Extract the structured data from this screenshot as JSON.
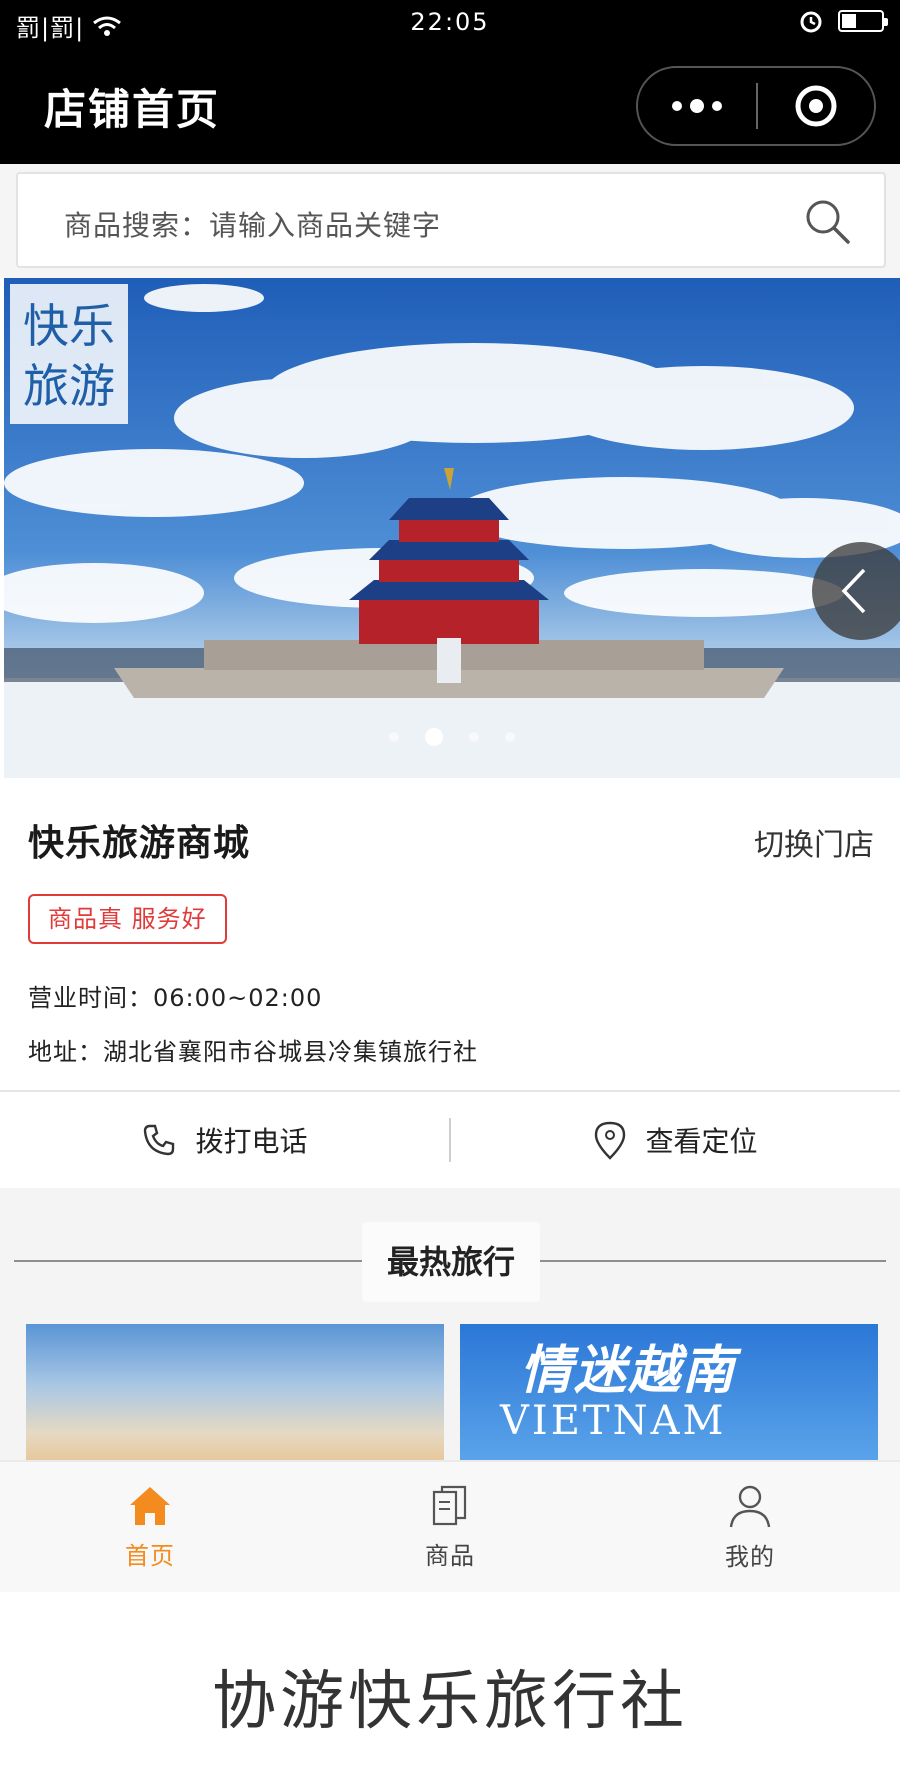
{
  "status_bar": {
    "signal": "罰|罰|",
    "time": "22:05"
  },
  "nav": {
    "title": "店铺首页"
  },
  "search": {
    "placeholder": "商品搜索：请输入商品关键字"
  },
  "banner": {
    "logo_line1": "快乐",
    "logo_line2": "旅游",
    "dot_count": 4,
    "active_index": 1
  },
  "store": {
    "name": "快乐旅游商城",
    "switch_label": "切换门店",
    "tag": "商品真 服务好",
    "hours": "营业时间：06:00~02:00",
    "address": "地址：湖北省襄阳市谷城县冷集镇旅行社"
  },
  "actions": {
    "call": "拨打电话",
    "navigate": "查看定位"
  },
  "section": {
    "title": "最热旅行",
    "cards": [
      {
        "title": "",
        "subtitle": ""
      },
      {
        "title": "情迷越南",
        "subtitle": "VIETNAM"
      }
    ]
  },
  "tabs": [
    {
      "label": "首页",
      "icon": "home-icon",
      "active": true
    },
    {
      "label": "商品",
      "icon": "book-icon",
      "active": false
    },
    {
      "label": "我的",
      "icon": "user-icon",
      "active": false
    }
  ],
  "footer": {
    "text": "协游快乐旅行社"
  },
  "colors": {
    "accent": "#f38b1f",
    "tag": "#e03a3a",
    "nav_bg": "#000000"
  }
}
